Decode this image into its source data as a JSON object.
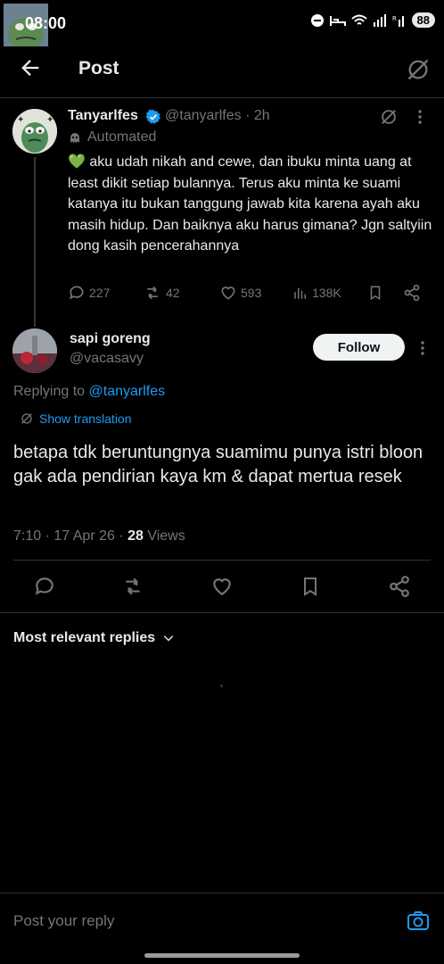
{
  "status_bar": {
    "time": "08:00",
    "battery": "88"
  },
  "header": {
    "title": "Post"
  },
  "parent_tweet": {
    "name": "Tanyarlfes",
    "handle": "@tanyarlfes",
    "time": "· 2h",
    "automated": "Automated",
    "emoji": "💚",
    "text": " aku udah nikah and cewe, dan ibuku minta uang at least dikit setiap bulannya. Terus aku minta ke suami katanya itu bukan tanggung jawab kita karena ayah aku masih hidup. Dan baiknya aku harus gimana? Jgn saltyiin dong kasih pencerahannya",
    "replies": "227",
    "reposts": "42",
    "likes": "593",
    "views": "138K"
  },
  "main_tweet": {
    "name": "sapi goreng",
    "handle": "@vacasavy",
    "follow_label": "Follow",
    "replying_prefix": "Replying to ",
    "replying_handle": "@tanyarlfes",
    "show_translation": "Show translation",
    "text": "betapa tdk beruntungnya suamimu punya istri bloon gak ada pendirian kaya km & dapat mertua resek",
    "timestamp": "7:10 · 17 Apr 26 · ",
    "views_count": "28",
    "views_label": " Views"
  },
  "replies_sort": {
    "label": "Most relevant replies"
  },
  "reply_box": {
    "placeholder": "Post your reply"
  }
}
